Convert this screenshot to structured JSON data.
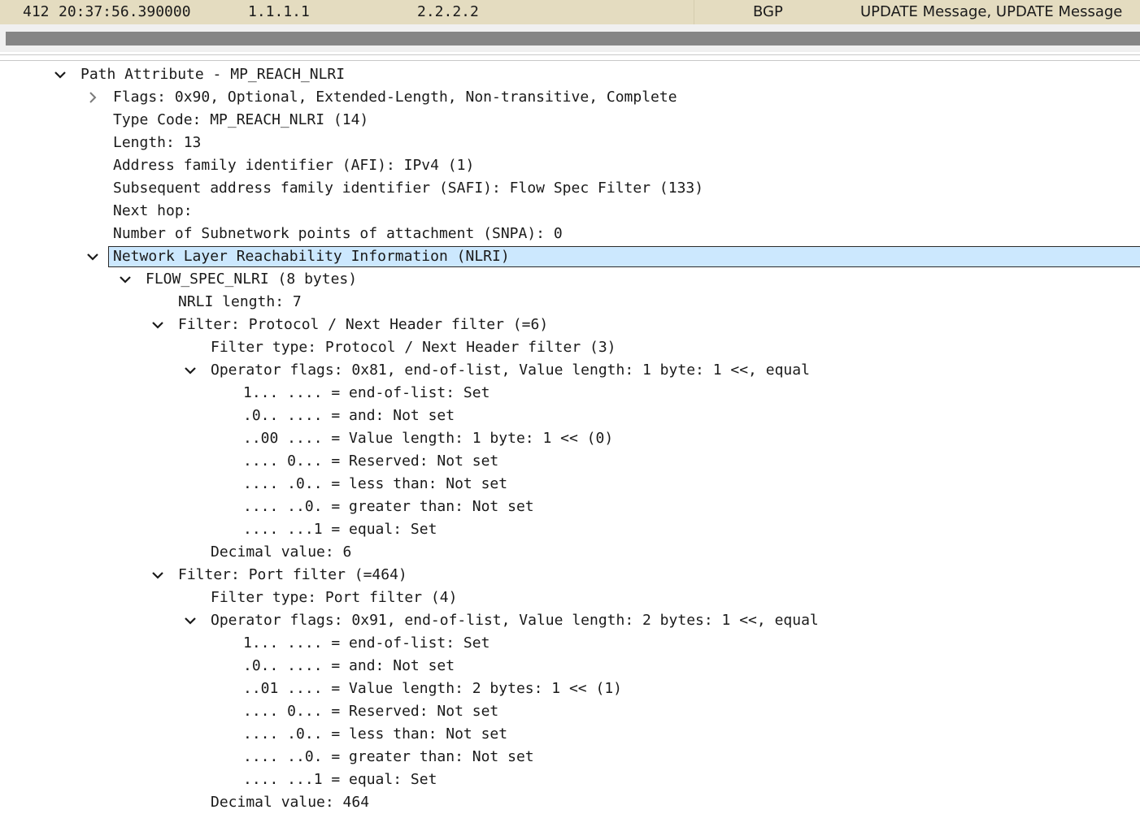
{
  "packet_row": {
    "no": "412",
    "time": "20:37:56.390000",
    "source": "1.1.1.1",
    "destination": "2.2.2.2",
    "protocol": "BGP",
    "info": "UPDATE Message, UPDATE Message"
  },
  "tree": {
    "rows": [
      {
        "level": 0,
        "toggle": "expanded",
        "text": "Path Attribute - MP_REACH_NLRI"
      },
      {
        "level": 1,
        "toggle": "collapsed",
        "text": "Flags: 0x90, Optional, Extended-Length, Non-transitive, Complete"
      },
      {
        "level": 1,
        "toggle": "none",
        "text": "Type Code: MP_REACH_NLRI (14)"
      },
      {
        "level": 1,
        "toggle": "none",
        "text": "Length: 13"
      },
      {
        "level": 1,
        "toggle": "none",
        "text": "Address family identifier (AFI): IPv4 (1)"
      },
      {
        "level": 1,
        "toggle": "none",
        "text": "Subsequent address family identifier (SAFI): Flow Spec Filter (133)"
      },
      {
        "level": 1,
        "toggle": "none",
        "text": "Next hop:"
      },
      {
        "level": 1,
        "toggle": "none",
        "text": "Number of Subnetwork points of attachment (SNPA): 0"
      },
      {
        "level": 1,
        "toggle": "expanded",
        "text": "Network Layer Reachability Information (NLRI)",
        "selected": true
      },
      {
        "level": 2,
        "toggle": "expanded",
        "text": "FLOW_SPEC_NLRI (8 bytes)"
      },
      {
        "level": 3,
        "toggle": "none",
        "text": "NRLI length: 7"
      },
      {
        "level": 3,
        "toggle": "expanded",
        "text": "Filter: Protocol / Next Header filter (=6)"
      },
      {
        "level": 4,
        "toggle": "none",
        "text": "Filter type: Protocol / Next Header filter (3)"
      },
      {
        "level": 4,
        "toggle": "expanded",
        "text": "Operator flags: 0x81, end-of-list, Value length: 1 byte: 1 <<, equal"
      },
      {
        "level": 5,
        "toggle": "none",
        "text": "1... .... = end-of-list: Set"
      },
      {
        "level": 5,
        "toggle": "none",
        "text": ".0.. .... = and: Not set"
      },
      {
        "level": 5,
        "toggle": "none",
        "text": "..00 .... = Value length: 1 byte: 1 << (0)"
      },
      {
        "level": 5,
        "toggle": "none",
        "text": ".... 0... = Reserved: Not set"
      },
      {
        "level": 5,
        "toggle": "none",
        "text": ".... .0.. = less than: Not set"
      },
      {
        "level": 5,
        "toggle": "none",
        "text": ".... ..0. = greater than: Not set"
      },
      {
        "level": 5,
        "toggle": "none",
        "text": ".... ...1 = equal: Set"
      },
      {
        "level": 4,
        "toggle": "none",
        "text": "Decimal value: 6"
      },
      {
        "level": 3,
        "toggle": "expanded",
        "text": "Filter: Port filter (=464)"
      },
      {
        "level": 4,
        "toggle": "none",
        "text": "Filter type: Port filter (4)"
      },
      {
        "level": 4,
        "toggle": "expanded",
        "text": "Operator flags: 0x91, end-of-list, Value length: 2 bytes: 1 <<, equal"
      },
      {
        "level": 5,
        "toggle": "none",
        "text": "1... .... = end-of-list: Set"
      },
      {
        "level": 5,
        "toggle": "none",
        "text": ".0.. .... = and: Not set"
      },
      {
        "level": 5,
        "toggle": "none",
        "text": "..01 .... = Value length: 2 bytes: 1 << (1)"
      },
      {
        "level": 5,
        "toggle": "none",
        "text": ".... 0... = Reserved: Not set"
      },
      {
        "level": 5,
        "toggle": "none",
        "text": ".... .0.. = less than: Not set"
      },
      {
        "level": 5,
        "toggle": "none",
        "text": ".... ..0. = greater than: Not set"
      },
      {
        "level": 5,
        "toggle": "none",
        "text": ".... ...1 = equal: Set"
      },
      {
        "level": 4,
        "toggle": "none",
        "text": "Decimal value: 464"
      }
    ]
  },
  "colors": {
    "packet_row_bg": "#e4dcc0",
    "selection_bg": "#cce8fe",
    "scrollbar_thumb": "#858585"
  }
}
